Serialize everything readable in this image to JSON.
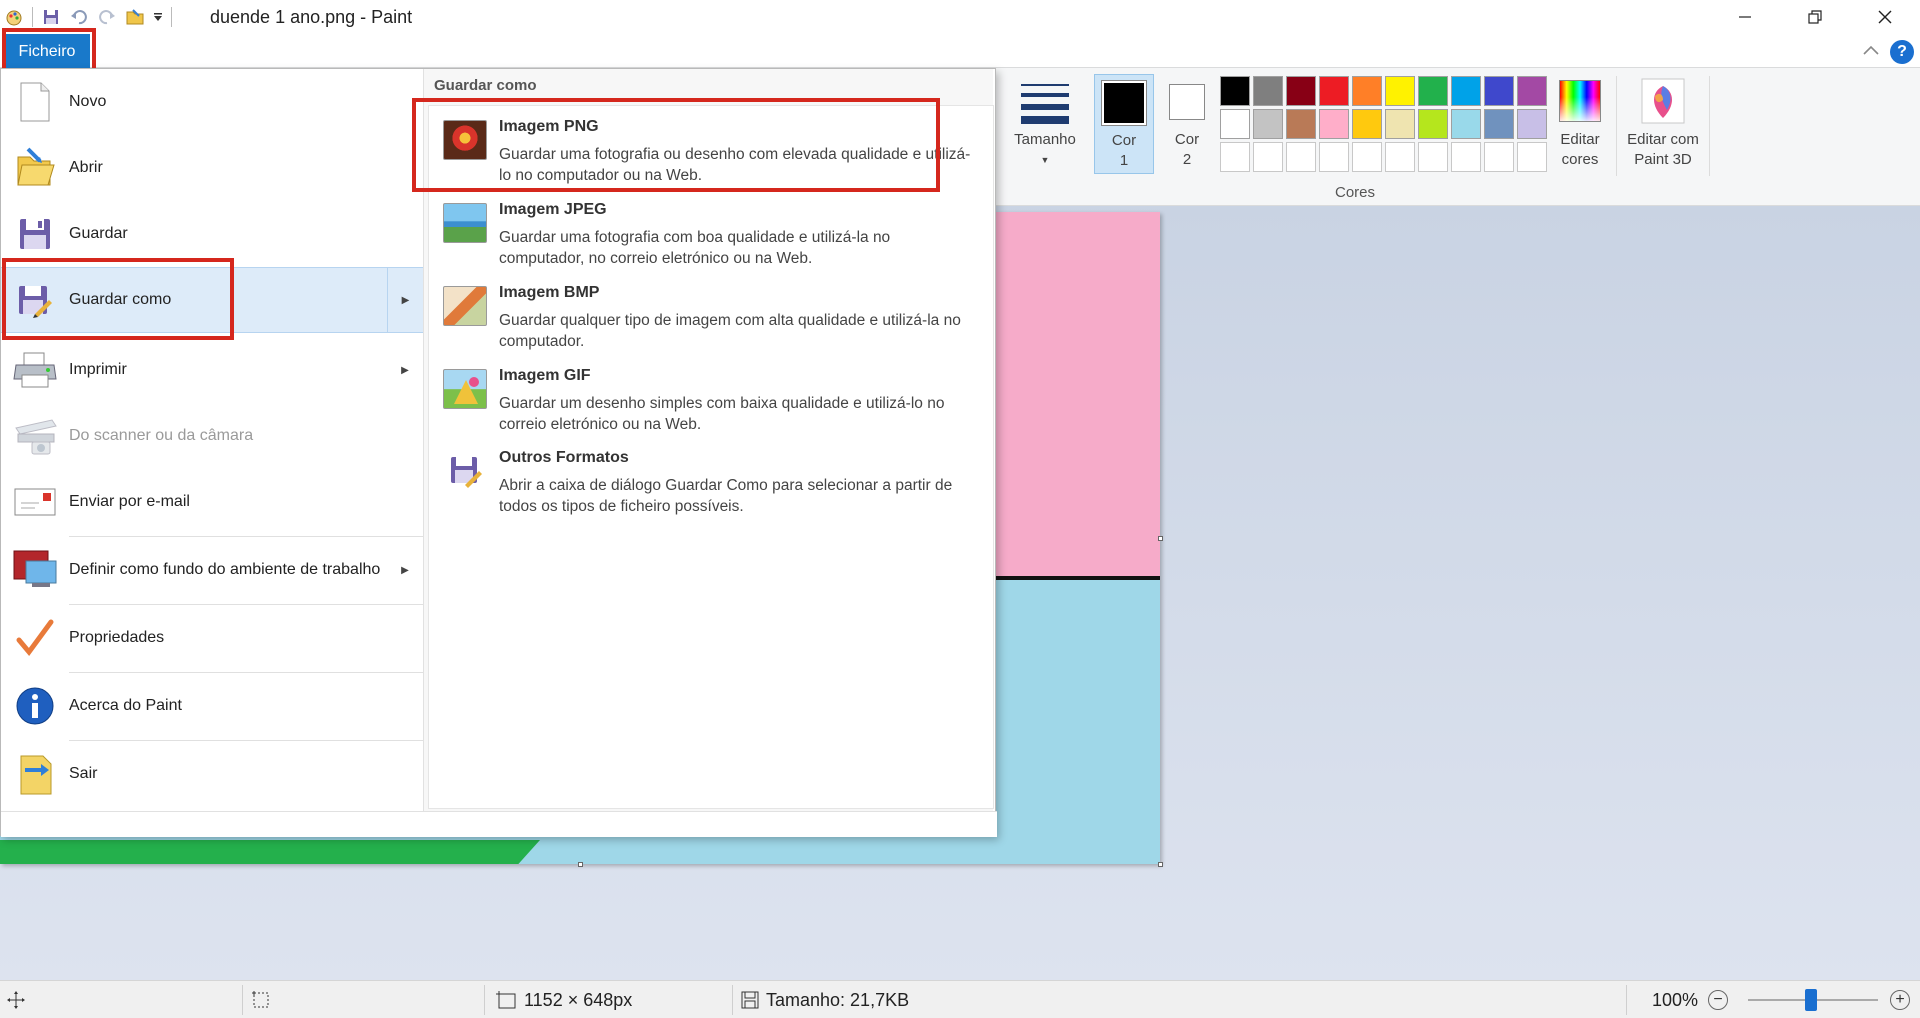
{
  "window": {
    "title": "duende 1 ano.png - Paint"
  },
  "ribbon": {
    "file_tab": "Ficheiro",
    "size_label": "Tamanho",
    "color1_label": "Cor\n1",
    "color1_line1": "Cor",
    "color1_line2": "1",
    "color2_line1": "Cor",
    "color2_line2": "2",
    "edit_colors_line1": "Editar",
    "edit_colors_line2": "cores",
    "paint3d_line1": "Editar com",
    "paint3d_line2": "Paint 3D",
    "colors_group_label": "Cores",
    "help": "?",
    "palette_row1": [
      "#000000",
      "#7f7f7f",
      "#880015",
      "#ed1c24",
      "#ff7f27",
      "#fff200",
      "#22b14c",
      "#00a2e8",
      "#3f48cc",
      "#a349a4"
    ],
    "palette_row2": [
      "#ffffff",
      "#c3c3c3",
      "#b97a57",
      "#ffaec9",
      "#ffc90e",
      "#efe4b0",
      "#b5e61d",
      "#99d9ea",
      "#7092be",
      "#c8bfe7"
    ]
  },
  "file_menu": {
    "items": [
      {
        "label": "Novo",
        "icon": "new-file-icon"
      },
      {
        "label": "Abrir",
        "icon": "open-folder-icon"
      },
      {
        "label": "Guardar",
        "icon": "save-icon"
      },
      {
        "label": "Guardar como",
        "icon": "save-as-icon"
      },
      {
        "label": "Imprimir",
        "icon": "printer-icon"
      },
      {
        "label": "Do scanner ou da câmara",
        "icon": "scanner-icon"
      },
      {
        "label": "Enviar por e-mail",
        "icon": "email-icon"
      },
      {
        "label": "Definir como fundo do ambiente de trabalho",
        "icon": "desktop-background-icon"
      },
      {
        "label": "Propriedades",
        "icon": "checkmark-icon"
      },
      {
        "label": "Acerca do Paint",
        "icon": "info-icon"
      },
      {
        "label": "Sair",
        "icon": "exit-icon"
      }
    ]
  },
  "save_as_menu": {
    "header": "Guardar como",
    "formats": [
      {
        "title": "Imagem PNG",
        "desc": "Guardar uma fotografia ou desenho com elevada qualidade e utilizá-lo no computador ou na Web."
      },
      {
        "title": "Imagem JPEG",
        "desc": "Guardar uma fotografia com boa qualidade e utilizá-la no computador, no correio eletrónico ou na Web."
      },
      {
        "title": "Imagem BMP",
        "desc": "Guardar qualquer tipo de imagem com alta qualidade e utilizá-la no computador."
      },
      {
        "title": "Imagem GIF",
        "desc": "Guardar um desenho simples com baixa qualidade e utilizá-lo no correio eletrónico ou na Web."
      },
      {
        "title": "Outros Formatos",
        "desc": "Abrir a caixa de diálogo Guardar Como para selecionar a partir de todos os tipos de ficheiro possíveis."
      }
    ]
  },
  "status": {
    "dimensions": "1152 × 648px",
    "file_size": "Tamanho: 21,7KB",
    "zoom": "100%"
  }
}
